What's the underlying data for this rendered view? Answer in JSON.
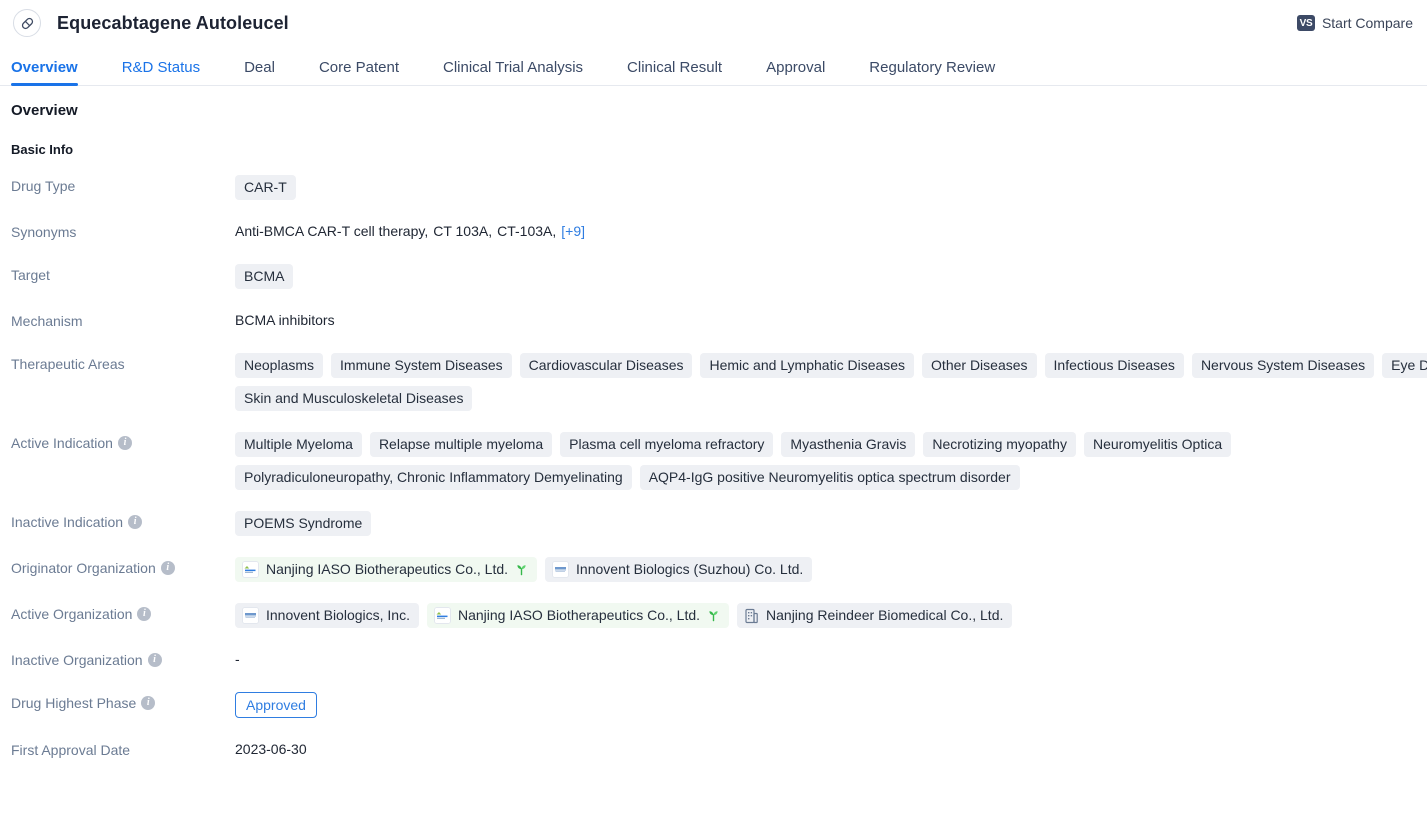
{
  "header": {
    "drug_title": "Equecabtagene Autoleucel",
    "drug_icon": "capsule-icon",
    "compare_badge": "VS",
    "compare_label": "Start Compare"
  },
  "tabs": [
    {
      "label": "Overview",
      "active": true
    },
    {
      "label": "R&D Status",
      "active": false
    },
    {
      "label": "Deal",
      "active": false
    },
    {
      "label": "Core Patent",
      "active": false
    },
    {
      "label": "Clinical Trial Analysis",
      "active": false
    },
    {
      "label": "Clinical Result",
      "active": false
    },
    {
      "label": "Approval",
      "active": false
    },
    {
      "label": "Regulatory Review",
      "active": false
    }
  ],
  "overview": {
    "section_title": "Overview",
    "basic_info_title": "Basic Info",
    "labels": {
      "drug_type": "Drug Type",
      "synonyms": "Synonyms",
      "target": "Target",
      "mechanism": "Mechanism",
      "therapeutic_areas": "Therapeutic Areas",
      "active_indication": "Active Indication",
      "inactive_indication": "Inactive Indication",
      "originator_organization": "Originator Organization",
      "active_organization": "Active Organization",
      "inactive_organization": "Inactive Organization",
      "drug_highest_phase": "Drug Highest Phase",
      "first_approval_date": "First Approval Date"
    },
    "drug_type": [
      "CAR-T"
    ],
    "synonyms": {
      "items": [
        "Anti-BMCA CAR-T cell therapy,",
        "CT 103A,",
        "CT-103A,"
      ],
      "more": "[+9]"
    },
    "target": [
      "BCMA"
    ],
    "mechanism": "BCMA inhibitors",
    "therapeutic_areas_row1": [
      "Neoplasms",
      "Immune System Diseases",
      "Cardiovascular Diseases",
      "Hemic and Lymphatic Diseases",
      "Other Diseases",
      "Infectious Diseases",
      "Nervous System Diseases",
      "Eye Diseases"
    ],
    "therapeutic_areas_row2": [
      "Skin and Musculoskeletal Diseases"
    ],
    "active_indication_row1": [
      "Multiple Myeloma",
      "Relapse multiple myeloma",
      "Plasma cell myeloma refractory",
      "Myasthenia Gravis",
      "Necrotizing myopathy",
      "Neuromyelitis Optica"
    ],
    "active_indication_row2": [
      "Polyradiculoneuropathy, Chronic Inflammatory Demyelinating",
      "AQP4-IgG positive Neuromyelitis optica spectrum disorder"
    ],
    "inactive_indication": [
      "POEMS Syndrome"
    ],
    "originator_organizations": [
      {
        "name": "Nanjing IASO Biotherapeutics Co., Ltd.",
        "style": "green",
        "logo": "iaso-logo-icon",
        "suffix_icon": "sprout-icon"
      },
      {
        "name": "Innovent Biologics (Suzhou) Co. Ltd.",
        "style": "gray",
        "logo": "innovent-logo-icon",
        "suffix_icon": ""
      }
    ],
    "active_organizations": [
      {
        "name": "Innovent Biologics, Inc.",
        "style": "gray",
        "logo": "innovent-logo-icon",
        "suffix_icon": ""
      },
      {
        "name": "Nanjing IASO Biotherapeutics Co., Ltd.",
        "style": "green",
        "logo": "iaso-logo-icon",
        "suffix_icon": "sprout-icon"
      },
      {
        "name": "Nanjing Reindeer Biomedical Co., Ltd.",
        "style": "gray",
        "logo": "building-icon",
        "suffix_icon": ""
      }
    ],
    "inactive_organization": "-",
    "drug_highest_phase": "Approved",
    "first_approval_date": "2023-06-30"
  },
  "colors": {
    "accent_blue": "#1a73e8",
    "link_blue": "#2f7de1",
    "label_gray": "#6b7b93",
    "tag_bg": "#eef0f4",
    "tag_green_bg": "#f1f9f1",
    "vs_badge_bg": "#3d4a66",
    "sprout_green": "#35b84a"
  }
}
